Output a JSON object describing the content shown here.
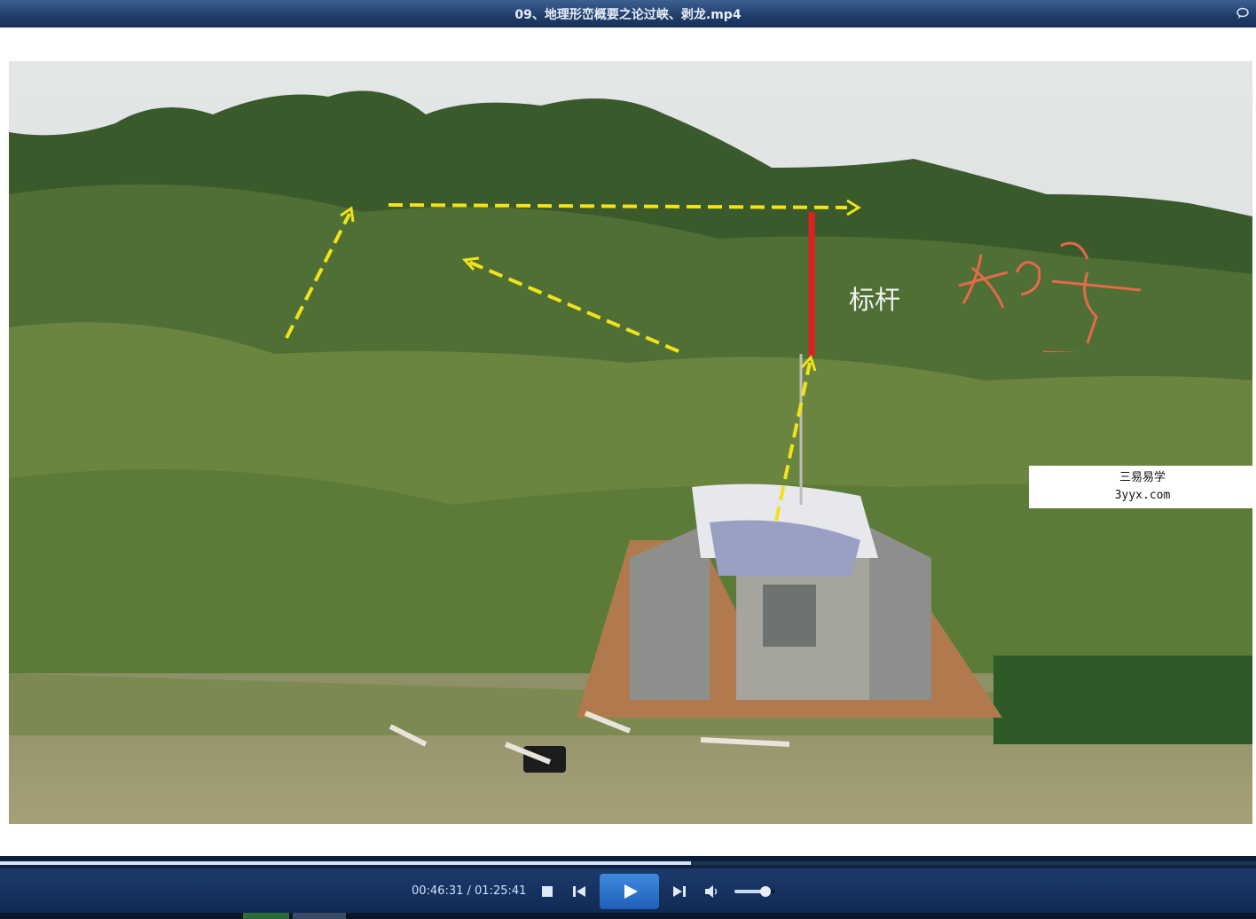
{
  "window": {
    "title": "09、地理形峦概要之论过峡、剥龙.mp4"
  },
  "video": {
    "annotation_text": "标杆",
    "handwriting": "如奇",
    "watermark_line1": "三易易学",
    "watermark_line2": "3yyx.com"
  },
  "player": {
    "time_display": "00:46:31 / 01:25:41",
    "progress_fraction": 0.55,
    "volume_fraction": 0.75,
    "icons": [
      "stop-icon",
      "previous-icon",
      "play-icon",
      "next-icon",
      "volume-icon"
    ]
  },
  "colors": {
    "accent_blue": "#2e76d0",
    "title_bar": "#1f3c68",
    "arrow_yellow": "#f2e21a",
    "marker_red": "#e02020"
  }
}
